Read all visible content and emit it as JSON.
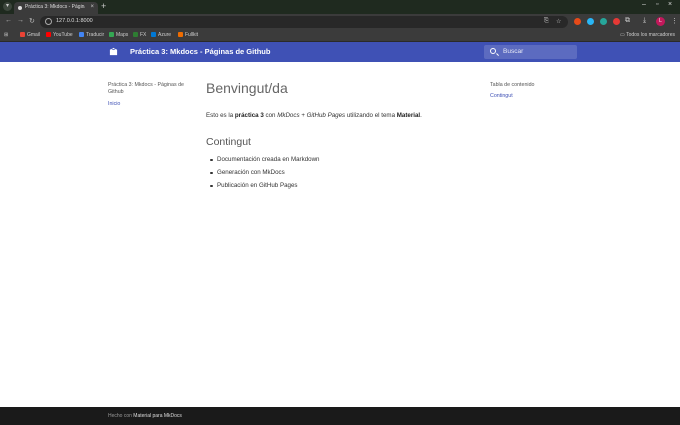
{
  "browser": {
    "tab_title": "Práctica 3: Mkdocs - Página",
    "url": "127.0.0.1:8000",
    "new_tab_glyph": "+",
    "close_glyph": "×",
    "bookmarks": [
      {
        "label": "Gmail",
        "color": "#ea4335"
      },
      {
        "label": "YouTube",
        "color": "#ff0000"
      },
      {
        "label": "Traducir",
        "color": "#4285f4"
      },
      {
        "label": "Maps",
        "color": "#34a853"
      },
      {
        "label": "FX",
        "color": "#2e7d32"
      },
      {
        "label": "Azure",
        "color": "#0078d4"
      },
      {
        "label": "Fullkit",
        "color": "#ef6c00"
      }
    ],
    "all_bookmarks": "Todos los marcadores",
    "profile_initial": "L"
  },
  "header": {
    "site_title": "Práctica 3: Mkdocs - Páginas de Github",
    "search_placeholder": "Buscar",
    "color": "#3f51b5"
  },
  "nav": {
    "site_title": "Práctica 3: Mkdocs - Páginas de Github",
    "items": [
      "Inicio"
    ]
  },
  "content": {
    "title": "Benvingut/da",
    "intro_prefix": "Esto es la ",
    "intro_bold": "práctica 3",
    "intro_mid": " con ",
    "intro_italic": "MkDocs + GitHub Pages",
    "intro_mid2": " utilizando el tema ",
    "intro_bold2": "Material",
    "intro_suffix": ".",
    "section_title": "Contingut",
    "list": [
      "Documentación creada en Markdown",
      "Generación con MkDocs",
      "Publicación en GitHub Pages"
    ]
  },
  "toc": {
    "title": "Tabla de contenido",
    "items": [
      "Contingut"
    ]
  },
  "footer": {
    "prefix": "Hecho con ",
    "highlight": "Material para MkDocs"
  }
}
